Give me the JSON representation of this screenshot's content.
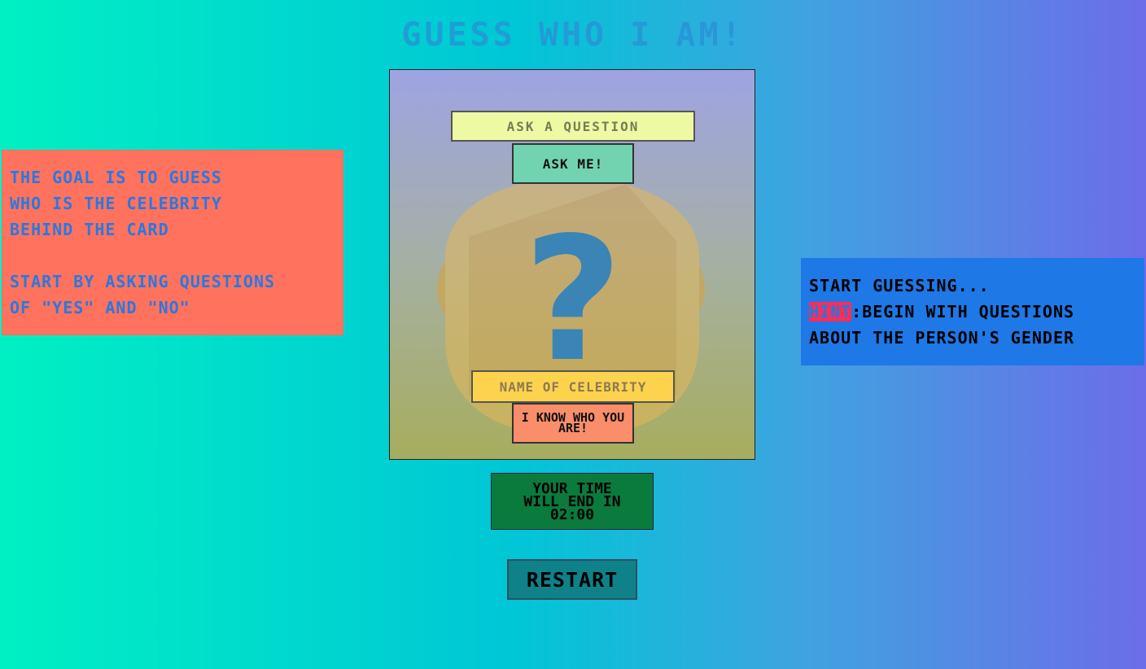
{
  "title": "GUESS WHO I AM!",
  "rules": {
    "line1": "THE GOAL IS TO GUESS",
    "line2": "WHO IS THE CELEBRITY",
    "line3": "BEHIND THE CARD",
    "line4": "START BY ASKING QUESTIONS",
    "line5": "OF \"YES\" AND \"NO\""
  },
  "hint_box": {
    "line1": "START GUESSING...",
    "hint_label": "HINT",
    "hint_text": ":BEGIN WITH QUESTIONS",
    "line3": "ABOUT THE PERSON'S GENDER"
  },
  "card": {
    "question_placeholder": "ASK A QUESTION",
    "ask_button": "ASK ME!",
    "mystery_symbol": "?",
    "name_placeholder": "NAME OF CELEBRITY",
    "guess_button": "I KNOW WHO YOU ARE!"
  },
  "timer": {
    "line1": "YOUR TIME",
    "line2": "WILL END IN",
    "time": "02:00"
  },
  "restart_button": "RESTART",
  "colors": {
    "rules_bg": "#ff725d",
    "hint_bg": "#1e78e6",
    "hint_highlight": "#ff2d55",
    "timer_bg": "#0b7a3d",
    "restart_bg": "#0f8189"
  }
}
